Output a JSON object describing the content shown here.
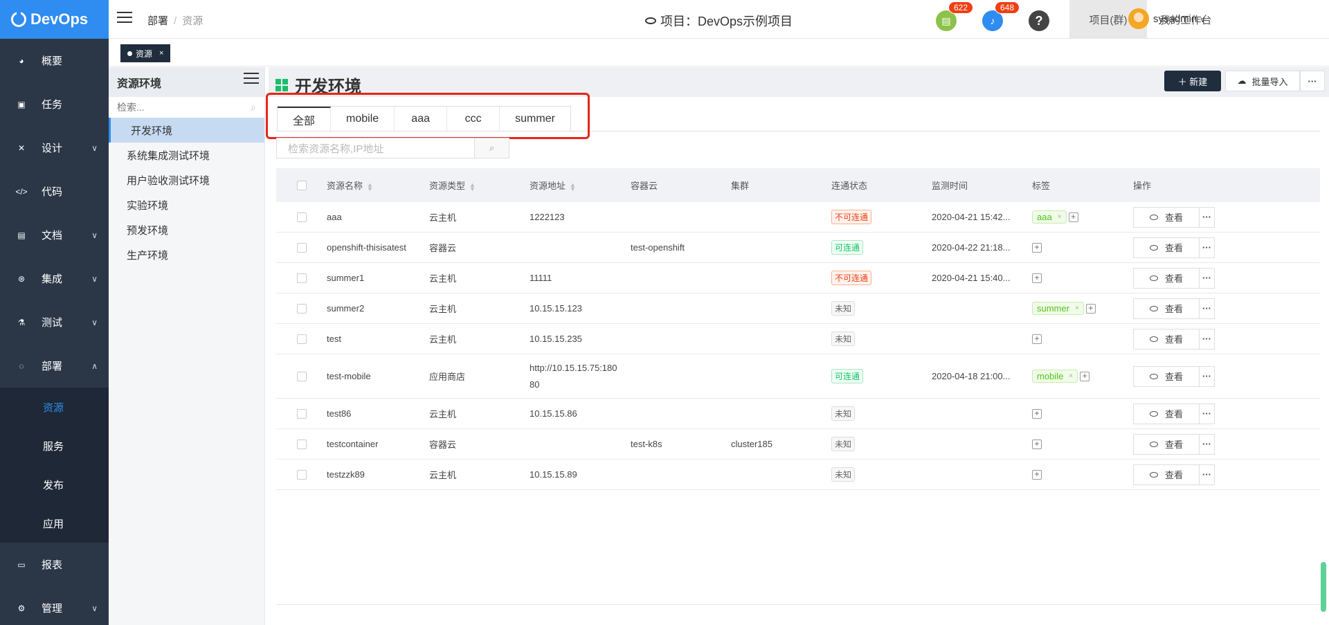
{
  "app": {
    "logo_text": "DevOps"
  },
  "nav": {
    "items": [
      {
        "label": "概要",
        "icon": "dashboard-icon",
        "chev": ""
      },
      {
        "label": "任务",
        "icon": "task-icon",
        "chev": ""
      },
      {
        "label": "设计",
        "icon": "design-icon",
        "chev": "∨"
      },
      {
        "label": "代码",
        "icon": "code-icon",
        "chev": ""
      },
      {
        "label": "文档",
        "icon": "document-icon",
        "chev": "∨"
      },
      {
        "label": "集成",
        "icon": "integration-icon",
        "chev": "∨"
      },
      {
        "label": "测试",
        "icon": "flask-icon",
        "chev": "∨"
      },
      {
        "label": "部署",
        "icon": "deploy-icon",
        "chev": "∧"
      }
    ],
    "sub_items": [
      {
        "label": "资源",
        "active": true
      },
      {
        "label": "服务"
      },
      {
        "label": "发布"
      },
      {
        "label": "应用"
      }
    ],
    "bottom_items": [
      {
        "label": "报表",
        "icon": "report-icon",
        "chev": ""
      },
      {
        "label": "管理",
        "icon": "gear-icon",
        "chev": "∨"
      }
    ]
  },
  "header": {
    "breadcrumb": [
      "部署",
      "资源"
    ],
    "project": "项目：DevOps示例项目",
    "badge1": "622",
    "badge2": "648",
    "help": "?",
    "tab_project": "项目(群)",
    "tab_workspace": "我的工作台",
    "username": "sysadmin"
  },
  "tagbar": {
    "chip": "资源",
    "close": "×"
  },
  "env_sidebar": {
    "title": "资源环境",
    "search_placeholder": "检索...",
    "items": [
      "开发环境",
      "系统集成测试环境",
      "用户验收测试环境",
      "实验环境",
      "预发环境",
      "生产环境"
    ]
  },
  "content": {
    "title": "开发环境",
    "new_label": "＋ 新建",
    "import_label": "批量导入",
    "more_label": "···",
    "tabs": [
      "全部",
      "mobile",
      "aaa",
      "ccc",
      "summer"
    ],
    "search_placeholder": "检索资源名称,IP地址"
  },
  "table": {
    "headers": [
      "资源名称",
      "资源类型",
      "资源地址",
      "容器云",
      "集群",
      "连通状态",
      "监测时间",
      "标签",
      "操作"
    ],
    "view_label": "查看",
    "more_label": "···",
    "rows": [
      {
        "name": "aaa",
        "type": "云主机",
        "addr": "1222123",
        "cloud": "",
        "cluster": "",
        "status": "不可连通",
        "status_kind": "bad",
        "time": "2020-04-21 15:42...",
        "tag": "aaa"
      },
      {
        "name": "openshift-thisisatest",
        "type": "容器云",
        "addr": "",
        "cloud": "test-openshift",
        "cluster": "",
        "status": "可连通",
        "status_kind": "ok",
        "time": "2020-04-22 21:18...",
        "tag": ""
      },
      {
        "name": "summer1",
        "type": "云主机",
        "addr": "11111",
        "cloud": "",
        "cluster": "",
        "status": "不可连通",
        "status_kind": "bad",
        "time": "2020-04-21 15:40...",
        "tag": ""
      },
      {
        "name": "summer2",
        "type": "云主机",
        "addr": "10.15.15.123",
        "cloud": "",
        "cluster": "",
        "status": "未知",
        "status_kind": "unk",
        "time": "",
        "tag": "summer"
      },
      {
        "name": "test",
        "type": "云主机",
        "addr": "10.15.15.235",
        "cloud": "",
        "cluster": "",
        "status": "未知",
        "status_kind": "unk",
        "time": "",
        "tag": ""
      },
      {
        "name": "test-mobile",
        "type": "应用商店",
        "addr": "http://10.15.15.75:18080",
        "cloud": "",
        "cluster": "",
        "status": "可连通",
        "status_kind": "ok",
        "time": "2020-04-18 21:00...",
        "tag": "mobile"
      },
      {
        "name": "test86",
        "type": "云主机",
        "addr": "10.15.15.86",
        "cloud": "",
        "cluster": "",
        "status": "未知",
        "status_kind": "unk",
        "time": "",
        "tag": ""
      },
      {
        "name": "testcontainer",
        "type": "容器云",
        "addr": "",
        "cloud": "test-k8s",
        "cluster": "cluster185",
        "status": "未知",
        "status_kind": "unk",
        "time": "",
        "tag": ""
      },
      {
        "name": "testzzk89",
        "type": "云主机",
        "addr": "10.15.15.89",
        "cloud": "",
        "cluster": "",
        "status": "未知",
        "status_kind": "unk",
        "time": "",
        "tag": ""
      }
    ]
  }
}
